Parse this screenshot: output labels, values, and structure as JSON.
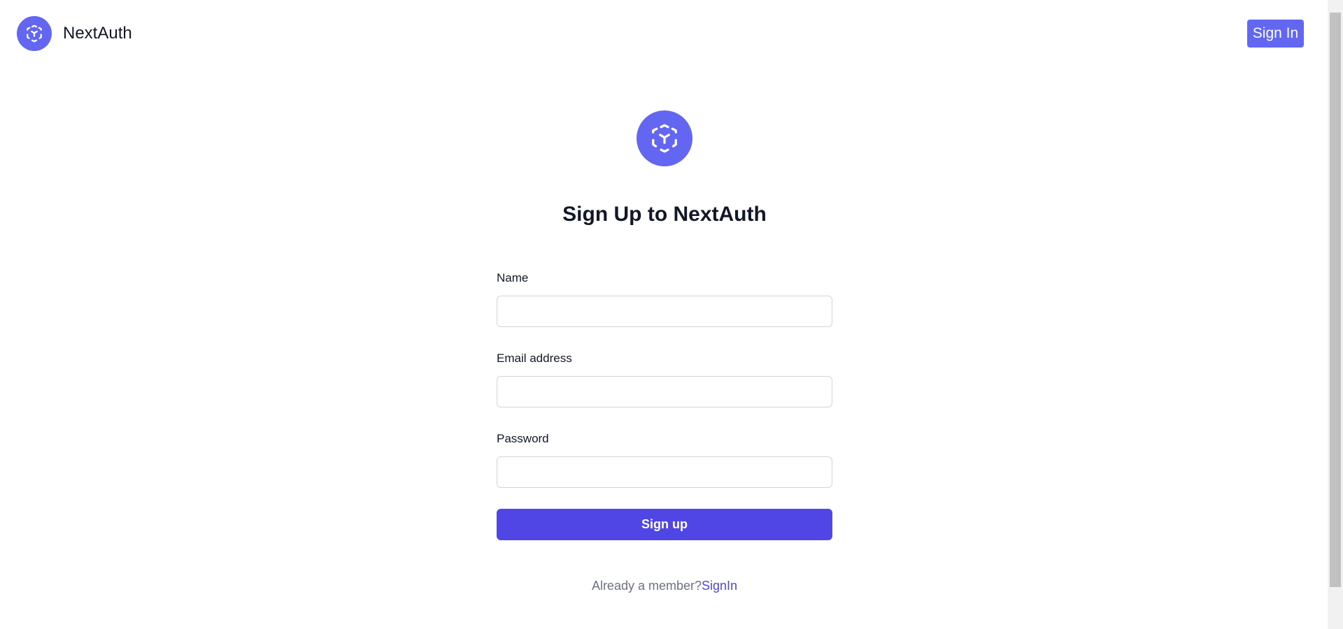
{
  "header": {
    "brand_name": "NextAuth",
    "signin_label": "Sign In"
  },
  "form": {
    "title": "Sign Up to NextAuth",
    "fields": [
      {
        "label": "Name",
        "value": "",
        "placeholder": ""
      },
      {
        "label": "Email address",
        "value": "",
        "placeholder": ""
      },
      {
        "label": "Password",
        "value": "",
        "placeholder": ""
      }
    ],
    "submit_label": "Sign up",
    "footer_text": "Already a member?",
    "footer_link": "SignIn"
  },
  "icons": {
    "brand_logo": "cube-logo-icon",
    "hero_logo": "cube-logo-icon"
  },
  "colors": {
    "brand": "#6366f1",
    "primary_button": "#4f46e5",
    "link": "#4f46e5",
    "text": "#111827",
    "muted_text": "#6b7280",
    "input_border": "#d1d5db"
  }
}
